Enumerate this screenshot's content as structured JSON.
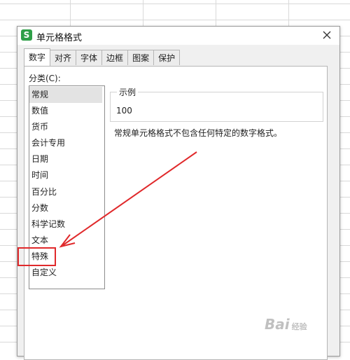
{
  "dialog": {
    "app_icon": "S",
    "title": "单元格格式",
    "close_icon": "close-icon"
  },
  "tabs": [
    {
      "label": "数字",
      "active": true
    },
    {
      "label": "对齐"
    },
    {
      "label": "字体"
    },
    {
      "label": "边框"
    },
    {
      "label": "图案"
    },
    {
      "label": "保护"
    }
  ],
  "category": {
    "label": "分类(C):",
    "items": [
      "常规",
      "数值",
      "货币",
      "会计专用",
      "日期",
      "时间",
      "百分比",
      "分数",
      "科学记数",
      "文本",
      "特殊",
      "自定义"
    ],
    "selected": "常规",
    "highlighted": "特殊"
  },
  "sample": {
    "legend": "示例",
    "value": "100"
  },
  "description": "常规单元格格式不包含任何特定的数字格式。",
  "annotation": {
    "highlight_color": "#e0292b",
    "arrow_color": "#e0292b"
  },
  "watermark": {
    "text": "Bai",
    "suffix": "经验"
  }
}
